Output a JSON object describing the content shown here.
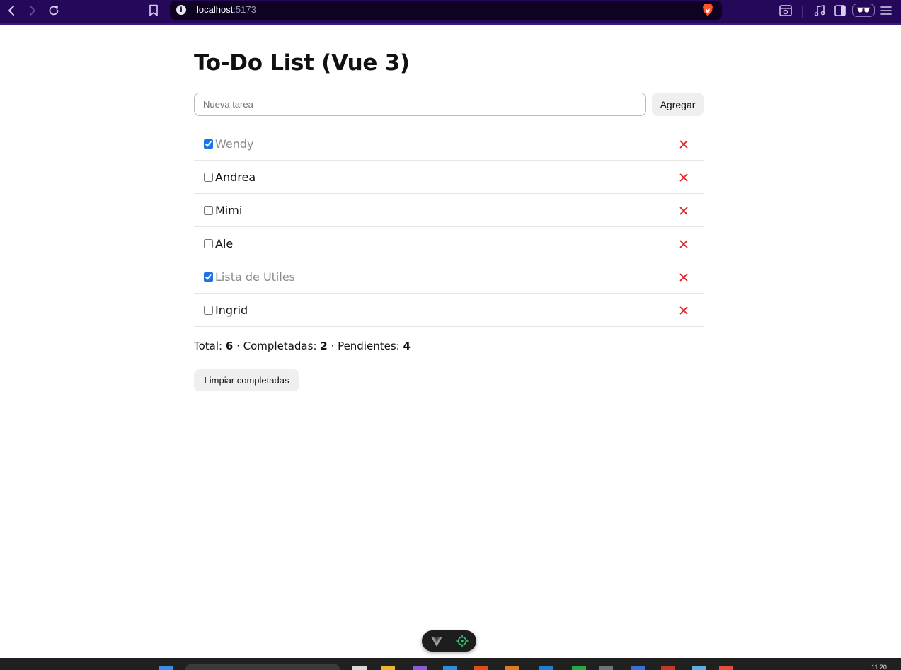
{
  "browser": {
    "url_host": "localhost",
    "url_port": ":5173"
  },
  "app": {
    "title": "To-Do List (Vue 3)",
    "new_task": {
      "placeholder": "Nueva tarea",
      "value": ""
    },
    "add_label": "Agregar",
    "delete_glyph": "✕",
    "tasks": [
      {
        "text": "Wendy",
        "done": true
      },
      {
        "text": "Andrea",
        "done": false
      },
      {
        "text": "Mimi",
        "done": false
      },
      {
        "text": "Ale",
        "done": false
      },
      {
        "text": "Lista de Utiles",
        "done": true
      },
      {
        "text": "Ingrid",
        "done": false
      }
    ],
    "summary": {
      "total_label": "Total:",
      "total": "6",
      "separator": "·",
      "completed_label": "Completadas:",
      "completed": "2",
      "pending_label": "Pendientes:",
      "pending": "4"
    },
    "clear_label": "Limpiar completadas"
  },
  "taskbar": {
    "clock": "11:20"
  },
  "colors": {
    "chrome_bg": "#25085a",
    "url_bg": "#0f0322",
    "delete_red": "#e02020",
    "checkbox_blue": "#1a73e8",
    "button_bg": "#efefef",
    "devtools_green": "#35c46c"
  },
  "icons": [
    "back-icon",
    "forward-icon",
    "reload-icon",
    "bookmark-icon",
    "info-icon",
    "brave-lion-icon",
    "screenshot-icon",
    "music-icon",
    "sidebar-icon",
    "private-glasses-icon",
    "menu-icon",
    "vue-logo-icon",
    "inspect-target-icon",
    "delete-x-icon"
  ]
}
